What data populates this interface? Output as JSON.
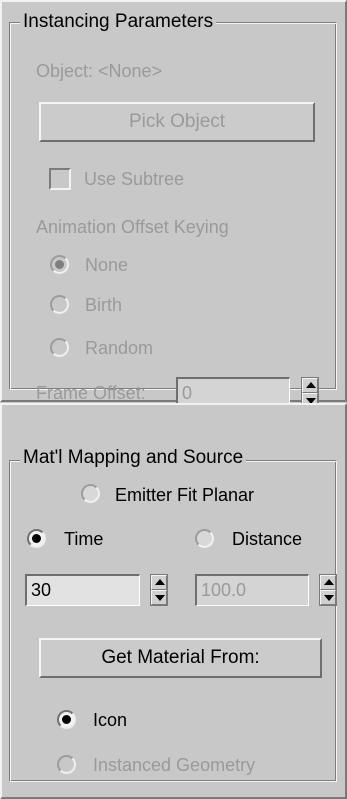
{
  "instancing": {
    "title": "Instancing Parameters",
    "object_label": "Object: <None>",
    "pick_object": "Pick Object",
    "use_subtree": {
      "label": "Use Subtree",
      "checked": false
    },
    "animation_offset_title": "Animation Offset Keying",
    "offset_options": [
      {
        "label": "None",
        "selected": true
      },
      {
        "label": "Birth",
        "selected": false
      },
      {
        "label": "Random",
        "selected": false
      }
    ],
    "frame_offset": {
      "label": "Frame Offset:",
      "value": "0"
    }
  },
  "mapping": {
    "title": "Mat'l Mapping and Source",
    "emitter_fit_planar": {
      "label": "Emitter Fit Planar",
      "selected": false
    },
    "time": {
      "label": "Time",
      "selected": true,
      "value": "30"
    },
    "distance": {
      "label": "Distance",
      "selected": false,
      "value": "100.0"
    },
    "get_material": "Get Material From:",
    "source_options": [
      {
        "label": "Icon",
        "selected": true
      },
      {
        "label": "Instanced Geometry",
        "selected": false
      }
    ]
  }
}
